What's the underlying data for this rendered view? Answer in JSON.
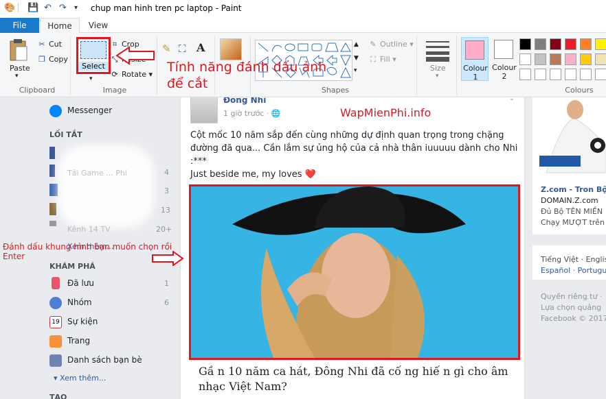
{
  "window": {
    "title": "chup man hinh tren pc laptop - Paint"
  },
  "tabs": {
    "file": "File",
    "home": "Home",
    "view": "View"
  },
  "ribbon": {
    "paste": "Paste",
    "cut": "Cut",
    "copy": "Copy",
    "select": "Select",
    "crop": "Crop",
    "resize": "Resize",
    "rotate": "Rotate",
    "outline": "Outline",
    "fill": "Fill",
    "size": "Size",
    "colour1": "Colour\n1",
    "colour1_a": "Colour",
    "colour1_b": "1",
    "colour2_a": "Colour",
    "colour2_b": "2",
    "groups": {
      "clipboard": "Clipboard",
      "image": "Image",
      "shapes": "Shapes",
      "colours": "Colours"
    },
    "palette": [
      "#000000",
      "#7f7f7f",
      "#880015",
      "#ed1c24",
      "#ff7f27",
      "#fff200",
      "#ffffff",
      "#c3c3c3",
      "#b97a57",
      "#ffaec9",
      "#ffc90e",
      "#efe4b0",
      "#ffffff",
      "#ffffff",
      "#ffffff",
      "#ffffff",
      "#ffffff",
      "#ffffff"
    ]
  },
  "annotations": {
    "feature": "Tính năng đánh dấu ảnh",
    "feature2": "để cắt",
    "instruction1": "Đánh dấu khung hình bạn muốn chọn rồi",
    "instruction2": "Enter",
    "watermark": "WapMienPhi.info"
  },
  "nav": {
    "messenger": "Messenger",
    "shortcuts": "LỐI TẮT",
    "shortcut_counts": [
      "4",
      "3",
      "13",
      "20+"
    ],
    "shortcut_label2": "Tải Game ... Phí",
    "shortcut_label5": "Kênh 14 TV",
    "see_more1": "Xem thêm...",
    "explore": "KHÁM PHÁ",
    "items": [
      {
        "label": "Đã lưu",
        "count": "1"
      },
      {
        "label": "Nhóm",
        "count": "6"
      },
      {
        "label": "Sự kiện",
        "count": ""
      },
      {
        "label": "Trang",
        "count": ""
      },
      {
        "label": "Danh sách bạn bè",
        "count": ""
      }
    ],
    "see_more2": "Xem thêm...",
    "create": "TẠO"
  },
  "post": {
    "author": "Đông Nhi",
    "time": "1 giờ trước ·",
    "text1": "Cột mốc 10 năm sắp đến cùng những dự định quan trọng trong chặng",
    "text2": "đường đã qua... Cần lắm sự ủng hộ của cả nhà thân iuuuuu dành cho Nhi",
    "text3": ":***",
    "text4": "Just beside me, my loves ❤️",
    "caption1": "Gầ n 10 năm ca hát, Đông Nhi đã cố ng hiế n gì cho âm",
    "caption2": "nhạc Việt Nam?"
  },
  "right": {
    "ad_title": "Z.com - Tron Bộ V",
    "ad_domain": "DOMAIN.Z.com",
    "ad_line1": "Đủ Bộ TÊN MIỀN",
    "ad_line2": "Chạy MƯỢT trên",
    "lang1": "Tiếng Việt · Englis",
    "lang2": "Español · Portugu",
    "footer1": "Quyền riêng tư ·",
    "footer2": "Lựa chọn quảng",
    "footer3": "Facebook © 2017"
  }
}
